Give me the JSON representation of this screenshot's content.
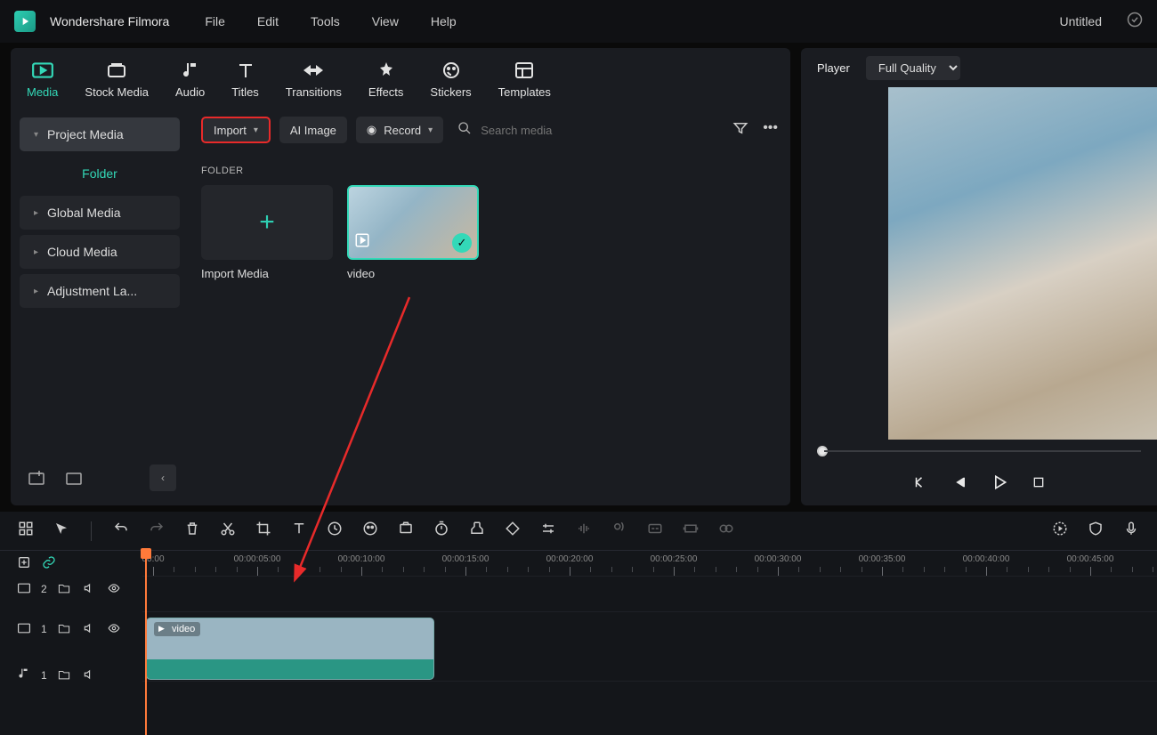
{
  "app": {
    "title": "Wondershare Filmora"
  },
  "menu": [
    "File",
    "Edit",
    "Tools",
    "View",
    "Help"
  ],
  "document": {
    "title": "Untitled"
  },
  "tabs": [
    {
      "key": "media",
      "label": "Media",
      "active": true
    },
    {
      "key": "stock",
      "label": "Stock Media"
    },
    {
      "key": "audio",
      "label": "Audio"
    },
    {
      "key": "titles",
      "label": "Titles"
    },
    {
      "key": "transitions",
      "label": "Transitions"
    },
    {
      "key": "effects",
      "label": "Effects"
    },
    {
      "key": "stickers",
      "label": "Stickers"
    },
    {
      "key": "templates",
      "label": "Templates"
    }
  ],
  "sidebar": {
    "project_media": "Project Media",
    "folder": "Folder",
    "global_media": "Global Media",
    "cloud_media": "Cloud Media",
    "adjustment": "Adjustment La..."
  },
  "toolbar": {
    "import": "Import",
    "ai_image": "AI Image",
    "record": "Record",
    "search_placeholder": "Search media"
  },
  "content": {
    "folder_label": "FOLDER",
    "import_media": "Import Media",
    "video_name": "video"
  },
  "preview": {
    "label": "Player",
    "quality": "Full Quality"
  },
  "timeline": {
    "ticks": [
      "00:00",
      "00:00:05:00",
      "00:00:10:00",
      "00:00:15:00",
      "00:00:20:00",
      "00:00:25:00",
      "00:00:30:00",
      "00:00:35:00",
      "00:00:40:00",
      "00:00:45:00"
    ],
    "clip_label": "video",
    "track_video_main": "1",
    "track_video_aux": "2",
    "track_audio": "1"
  }
}
